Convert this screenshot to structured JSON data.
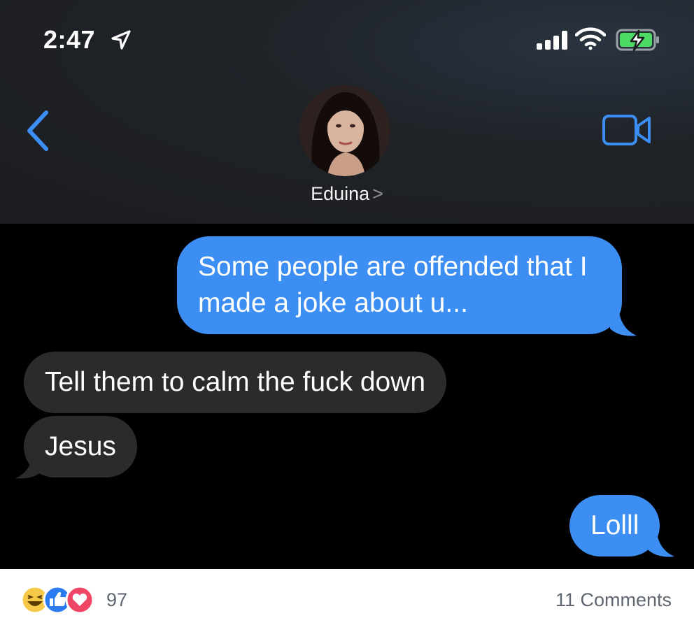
{
  "status_bar": {
    "time": "2:47"
  },
  "header": {
    "contact_name": "Eduina",
    "chevron": ">"
  },
  "messages": [
    {
      "from": "me",
      "text": "Some people are offended that I made a joke about u..."
    },
    {
      "from": "them",
      "text": "Tell them to calm the fuck down"
    },
    {
      "from": "them",
      "text": "Jesus"
    },
    {
      "from": "me",
      "text": "Lolll"
    }
  ],
  "footer": {
    "reaction_count": "97",
    "comments": "11 Comments"
  },
  "colors": {
    "sent_bubble": "#3c8ef3",
    "received_bubble": "#2b2b2d",
    "accent": "#3c8ef3",
    "battery": "#4cd964"
  },
  "icons": [
    "location-arrow-icon",
    "signal-icon",
    "wifi-icon",
    "battery-charging-icon",
    "back-chevron-icon",
    "video-camera-icon",
    "haha-reaction-icon",
    "like-reaction-icon",
    "love-reaction-icon"
  ]
}
